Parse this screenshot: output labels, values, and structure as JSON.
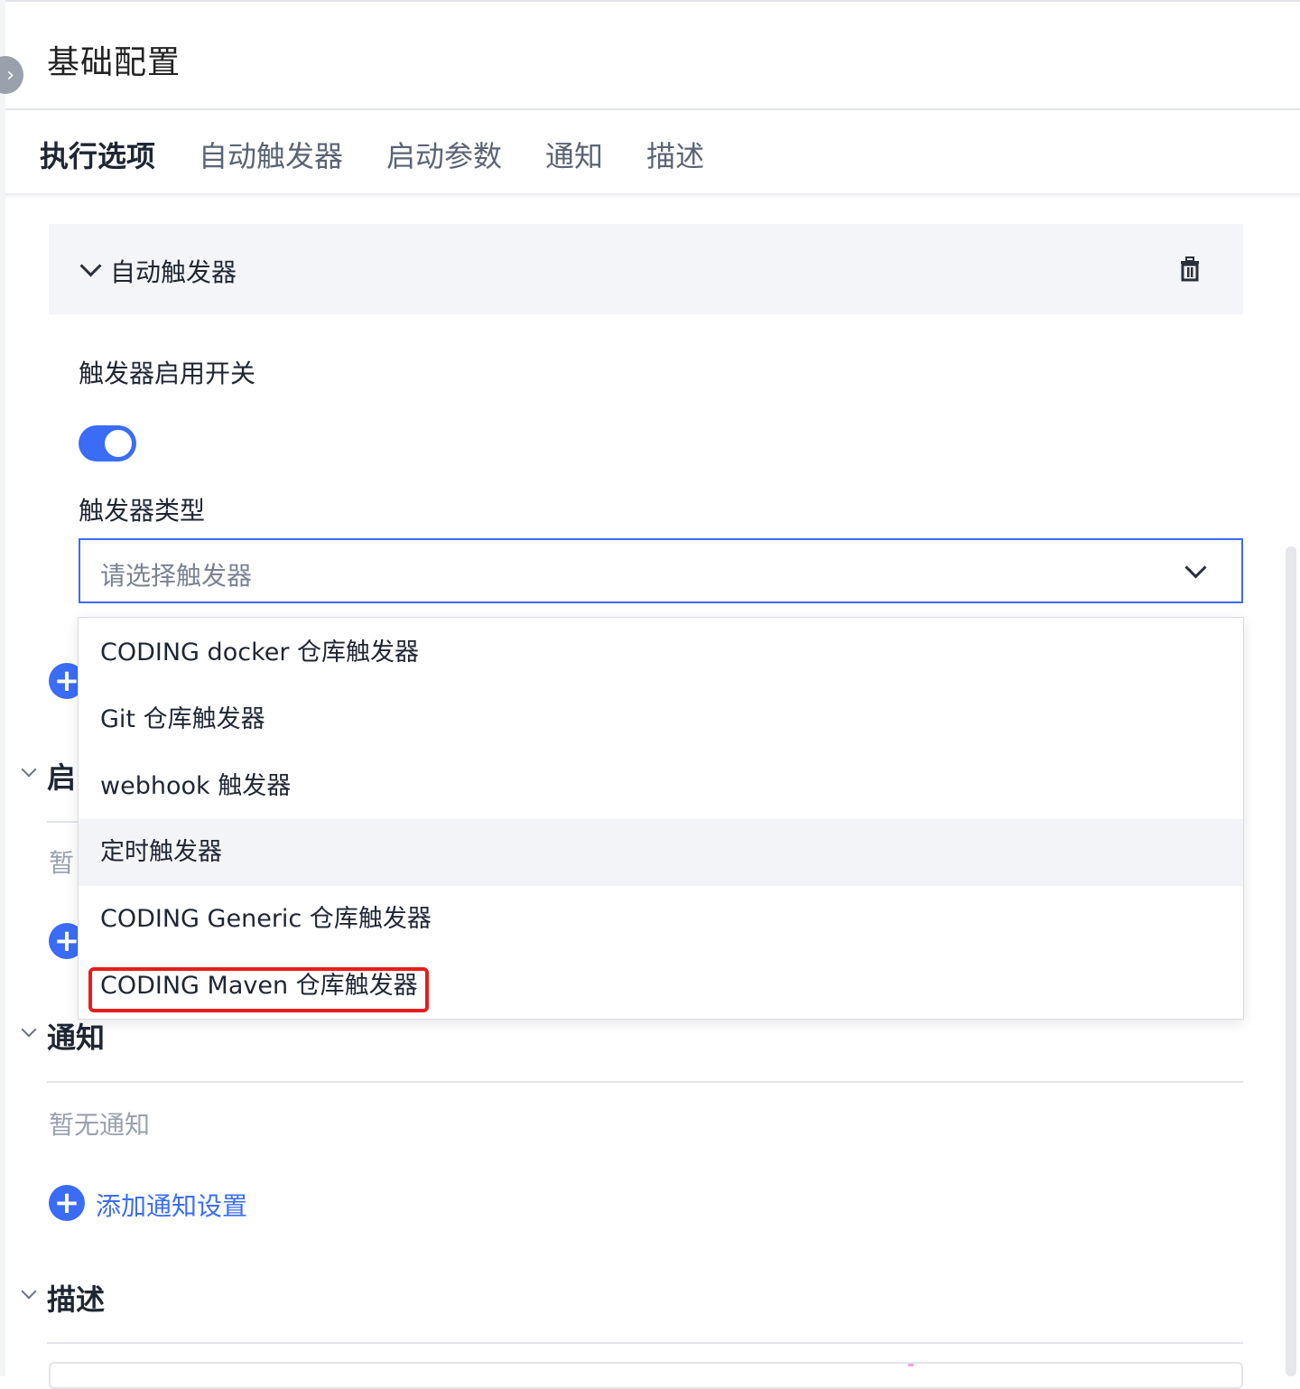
{
  "header": {
    "title": "基础配置",
    "collapse_icon": "chevron-right-icon"
  },
  "tabs": [
    {
      "label": "执行选项",
      "active": true
    },
    {
      "label": "自动触发器",
      "active": false
    },
    {
      "label": "启动参数",
      "active": false
    },
    {
      "label": "通知",
      "active": false
    },
    {
      "label": "描述",
      "active": false
    }
  ],
  "trigger": {
    "title": "自动触发器",
    "delete_icon": "trash-icon",
    "switch_label": "触发器启用开关",
    "switch_on": true,
    "type_label": "触发器类型",
    "select_placeholder": "请选择触发器"
  },
  "dropdown": {
    "options": [
      "CODING docker 仓库触发器",
      "Git 仓库触发器",
      "webhook 触发器",
      "定时触发器",
      "CODING Generic 仓库触发器",
      "CODING Maven 仓库触发器"
    ],
    "hovered_index": 3,
    "highlighted_index": 5
  },
  "sections": {
    "start_params": {
      "title_partial": "启",
      "empty_partial": "暂"
    },
    "notify": {
      "title": "通知",
      "empty": "暂无通知",
      "add_label": "添加通知设置"
    },
    "description": {
      "title": "描述"
    }
  },
  "colors": {
    "accent": "#3b6cf6",
    "highlight": "#e81c1c"
  }
}
